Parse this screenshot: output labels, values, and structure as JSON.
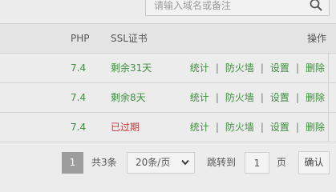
{
  "search": {
    "placeholder": "请输入域名或备注"
  },
  "table": {
    "headers": {
      "php": "PHP",
      "ssl": "SSL证书",
      "operations": "操作"
    },
    "rows": [
      {
        "php": "7.4",
        "ssl": "剩余31天",
        "ssl_status": "valid"
      },
      {
        "php": "7.4",
        "ssl": "剩余8天",
        "ssl_status": "valid"
      },
      {
        "php": "7.4",
        "ssl": "已过期",
        "ssl_status": "expired"
      }
    ],
    "actions": {
      "stats": "统计",
      "firewall": "防火墙",
      "settings": "设置",
      "delete": "删除",
      "separator": "|"
    }
  },
  "pagination": {
    "current_page": "1",
    "total": "共3条",
    "page_size": "20条/页",
    "jump_label": "跳转到",
    "jump_value": "1",
    "page_unit": "页",
    "confirm": "确认"
  },
  "colors": {
    "accent_green": "#3e8f3e",
    "expired_red": "#c23a3a",
    "active_page": "#9d9d9d"
  }
}
